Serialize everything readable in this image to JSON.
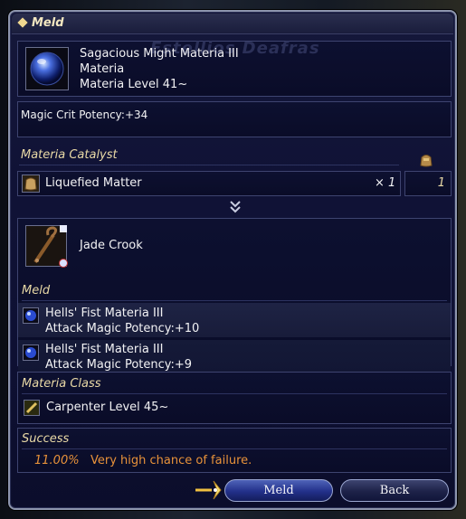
{
  "window": {
    "title": "Meld",
    "header_watermark": "Estellios Deafras"
  },
  "materia": {
    "name": "Sagacious Might Materia III",
    "type": "Materia",
    "level": "Materia Level  41~",
    "effect": "Magic Crit Potency:+34"
  },
  "catalyst": {
    "heading": "Materia Catalyst",
    "item_name": "Liquefied Matter",
    "quantity": "× 1",
    "owned": "1"
  },
  "target": {
    "item_name": "Jade Crook",
    "meld_heading": "Meld",
    "melds": [
      {
        "name": "Hells' Fist Materia III",
        "effect": "Attack Magic Potency:+10"
      },
      {
        "name": "Hells' Fist Materia III",
        "effect": "Attack Magic Potency:+9"
      }
    ]
  },
  "materia_class": {
    "heading": "Materia Class",
    "value": "Carpenter Level 45~"
  },
  "success": {
    "heading": "Success",
    "rate": "11.00%",
    "message": "Very high chance of failure."
  },
  "buttons": {
    "meld": "Meld",
    "back": "Back"
  },
  "colors": {
    "accent_gold": "#e9d9a6",
    "warning_orange": "#e8923a",
    "window_bg": "#101236"
  }
}
